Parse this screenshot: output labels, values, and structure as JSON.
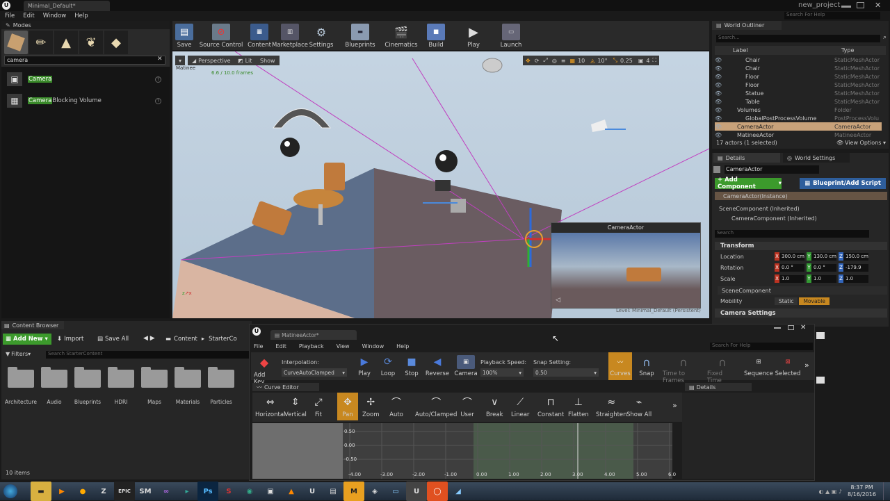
{
  "window": {
    "title": "Minimal_Default*",
    "project": "new_project",
    "search_help": "Search For Help"
  },
  "menu": [
    "File",
    "Edit",
    "Window",
    "Help"
  ],
  "modes": {
    "title": "Modes",
    "search_value": "camera",
    "results": [
      {
        "highlight": "Camera",
        "rest": ""
      },
      {
        "highlight": "Camera",
        "rest": " Blocking Volume"
      }
    ]
  },
  "toolbar": [
    "Save",
    "Source Control",
    "Content",
    "Marketplace",
    "Settings",
    "Blueprints",
    "Cinematics",
    "Build",
    "Play",
    "Launch"
  ],
  "viewport": {
    "perspective": "Perspective",
    "lit": "Lit",
    "show": "Show",
    "matinee_label": "Matinee",
    "frames": "6.6 / 10.0 frames",
    "snap_grid": "10",
    "snap_rot": "10°",
    "snap_scale": "0.25",
    "cam_speed": "4",
    "pip_title": "CameraActor",
    "level_label": "Level:  Minimal_Default (Persistent)"
  },
  "outliner": {
    "title": "World Outliner",
    "search_placeholder": "Search...",
    "col_label": "Label",
    "col_type": "Type",
    "rows": [
      {
        "label": "Chair",
        "type": "StaticMeshActor",
        "indent": 2
      },
      {
        "label": "Chair",
        "type": "StaticMeshActor",
        "indent": 2
      },
      {
        "label": "Floor",
        "type": "StaticMeshActor",
        "indent": 2
      },
      {
        "label": "Floor",
        "type": "StaticMeshActor",
        "indent": 2
      },
      {
        "label": "Statue",
        "type": "StaticMeshActor",
        "indent": 2
      },
      {
        "label": "Table",
        "type": "StaticMeshActor",
        "indent": 2
      },
      {
        "label": "Volumes",
        "type": "Folder",
        "indent": 1
      },
      {
        "label": "GlobalPostProcessVolume",
        "type": "PostProcessVolu",
        "indent": 2
      },
      {
        "label": "CameraActor",
        "type": "CameraActor",
        "indent": 1,
        "selected": true
      },
      {
        "label": "MatineeActor",
        "type": "MatineeActor",
        "indent": 1
      }
    ],
    "footer": "17 actors (1 selected)",
    "view_options": "View Options"
  },
  "details": {
    "tab": "Details",
    "tab2": "World Settings",
    "name_value": "CameraActor",
    "add_component": "+ Add Component",
    "blueprint": "Blueprint/Add Script",
    "instance": "CameraActor(Instance)",
    "components": [
      "SceneComponent (Inherited)",
      "CameraComponent (Inherited)"
    ],
    "search_placeholder": "Search",
    "transform": "Transform",
    "location_label": "Location",
    "rotation_label": "Rotation",
    "scale_label": "Scale",
    "location": [
      "300.0 cm",
      "130.0 cm",
      "150.0 cm"
    ],
    "rotation": [
      "0.0 °",
      "0.0 °",
      "-179.9"
    ],
    "scale": [
      "1.0",
      "1.0",
      "1.0"
    ],
    "scene_component": "SceneComponent",
    "mobility_label": "Mobility",
    "static": "Static",
    "movable": "Movable",
    "camera_settings": "Camera Settings"
  },
  "content_browser": {
    "title": "Content Browser",
    "add_new": "Add New",
    "import": "Import",
    "save_all": "Save All",
    "crumb1": "Content",
    "crumb2": "StarterCo",
    "filters": "Filters",
    "search_placeholder": "Search StarterContent",
    "folders": [
      "Architecture",
      "Audio",
      "Blueprints",
      "HDRI",
      "Maps",
      "Materials",
      "Particles"
    ],
    "count": "10 items"
  },
  "matinee": {
    "tab": "MatineeActor*",
    "menu": [
      "File",
      "Edit",
      "Playback",
      "View",
      "Window",
      "Help"
    ],
    "search_placeholder": "Search For Help",
    "interp_label": "Interpolation:",
    "interp_value": "CurveAutoClamped",
    "speed_label": "Playback Speed:",
    "speed_value": "100%",
    "snap_label": "Snap Setting:",
    "snap_value": "0.50",
    "tools": [
      "Add Key",
      "Play",
      "Loop",
      "Stop",
      "Reverse",
      "Camera",
      "Curves",
      "Snap",
      "Time to Frames",
      "Fixed Time",
      "Sequence",
      "Selected"
    ],
    "curve_tab": "Curve Editor",
    "details_tab": "Details",
    "curve_tools": [
      "Horizontal",
      "Vertical",
      "Fit",
      "Pan",
      "Zoom",
      "Auto",
      "Auto/Clamped",
      "User",
      "Break",
      "Linear",
      "Constant",
      "Flatten",
      "Straighten",
      "Show All"
    ],
    "y_ticks": [
      "0.50",
      "0.00",
      "-0.50"
    ],
    "x_ticks": [
      "-4.00",
      "-3.00",
      "-2.00",
      "-1.00",
      "0.00",
      "1.00",
      "2.00",
      "3.00",
      "4.00",
      "5.00",
      "6.0"
    ]
  },
  "taskbar": {
    "time": "8:37 PM",
    "date": "8/16/2016"
  }
}
